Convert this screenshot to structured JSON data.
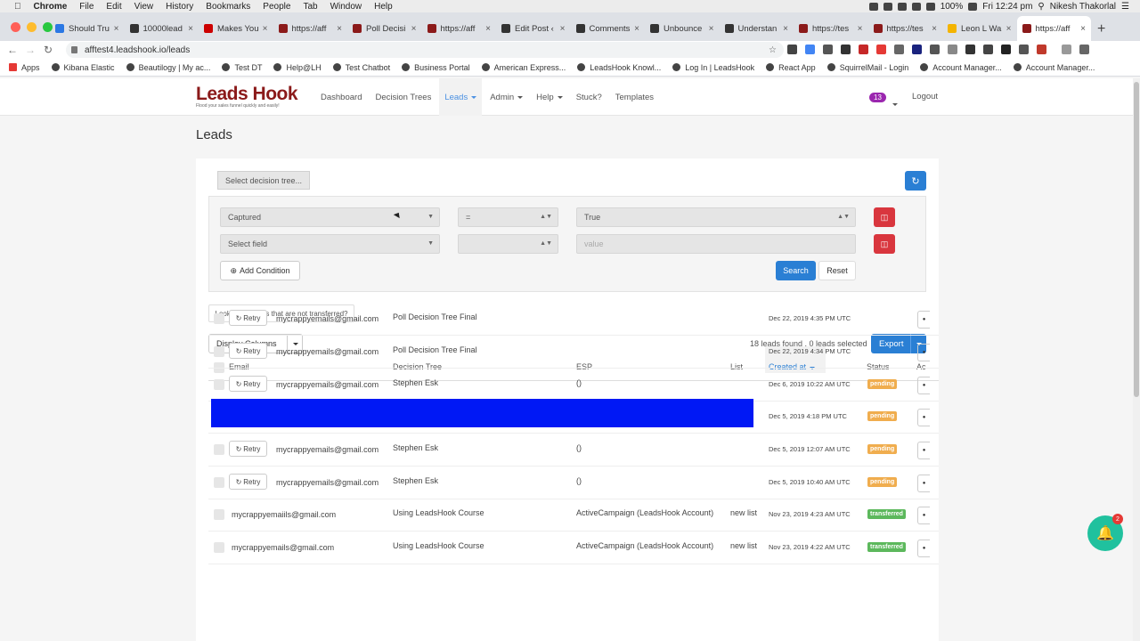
{
  "macos": {
    "menu": [
      "Chrome",
      "File",
      "Edit",
      "View",
      "History",
      "Bookmarks",
      "People",
      "Tab",
      "Window",
      "Help"
    ],
    "battery": "100%",
    "time": "Fri 12:24 pm",
    "user": "Nikesh Thakorlal"
  },
  "tabs": [
    {
      "title": "Should Tru",
      "color": "#2b78e4"
    },
    {
      "title": "10000lead",
      "color": "#333333"
    },
    {
      "title": "Makes You",
      "color": "#cc0000"
    },
    {
      "title": "https://aff",
      "color": "#8b1a1a"
    },
    {
      "title": "Poll Decisi",
      "color": "#8b1a1a"
    },
    {
      "title": "https://aff",
      "color": "#8b1a1a"
    },
    {
      "title": "Edit Post ‹",
      "color": "#333333"
    },
    {
      "title": "Comments",
      "color": "#333333"
    },
    {
      "title": "Unbounce",
      "color": "#333333"
    },
    {
      "title": "Understan",
      "color": "#333333"
    },
    {
      "title": "https://tes",
      "color": "#8b1a1a"
    },
    {
      "title": "https://tes",
      "color": "#8b1a1a"
    },
    {
      "title": "Leon L Wa",
      "color": "#f4b400"
    },
    {
      "title": "https://aff",
      "color": "#8b1a1a",
      "active": true
    }
  ],
  "address": {
    "url": "afftest4.leadshook.io/leads"
  },
  "bookmarks": [
    "Apps",
    "Kibana Elastic",
    "Beautilogy | My ac...",
    "Test DT",
    "Help@LH",
    "Test Chatbot",
    "Business Portal",
    "American Express...",
    "LeadsHook Knowl...",
    "Log In | LeadsHook",
    "React App",
    "SquirrelMail - Login",
    "Account Manager...",
    "Account Manager..."
  ],
  "brand": {
    "name": "Leads Hook",
    "tagline": "Flood your sales funnel quickly and easily!",
    "color": "#8b1a1a"
  },
  "nav": {
    "items": [
      {
        "label": "Dashboard",
        "dropdown": false
      },
      {
        "label": "Decision Trees",
        "dropdown": false
      },
      {
        "label": "Leads",
        "dropdown": true,
        "active": true
      },
      {
        "label": "Admin",
        "dropdown": true
      },
      {
        "label": "Help",
        "dropdown": true
      },
      {
        "label": "Stuck?",
        "dropdown": false
      },
      {
        "label": "Templates",
        "dropdown": false
      }
    ],
    "notifications": "13",
    "logout": "Logout"
  },
  "page": {
    "title": "Leads"
  },
  "filters": {
    "decision_tree_placeholder": "Select decision tree...",
    "conditions": [
      {
        "field": "Captured",
        "operator": "=",
        "value": "True"
      },
      {
        "field": "Select field",
        "operator": "",
        "value": "",
        "value_placeholder": "value"
      }
    ],
    "add_condition": "Add Condition",
    "search": "Search",
    "reset": "Reset"
  },
  "not_transferred_link": "Looking for leads that are not transferred?",
  "display_columns": "Display Columns",
  "results_summary": "18 leads found , 0 leads selected",
  "export": "Export",
  "table": {
    "headers": {
      "email": "Email",
      "tree": "Decision Tree",
      "esp": "ESP",
      "list": "List",
      "created": "Created at",
      "status": "Status",
      "actions": "Ac"
    },
    "retry_label": "Retry",
    "rows": [
      {
        "retry": true,
        "email": "mycrappyemails@gmail.com",
        "tree": "Poll Decision Tree Final",
        "esp": "",
        "list": "",
        "created": "Dec 22, 2019 4:35 PM UTC",
        "status": ""
      },
      {
        "retry": true,
        "email": "mycrappyemails@gmail.com",
        "tree": "Poll Decision Tree Final",
        "esp": "",
        "list": "",
        "created": "Dec 22, 2019 4:34 PM UTC",
        "status": ""
      },
      {
        "retry": true,
        "email": "mycrappyemails@gmail.com",
        "tree": "Stephen Esk",
        "esp": "()",
        "list": "",
        "created": "Dec 6, 2019 10:22 AM UTC",
        "status": "pending"
      },
      {
        "retry": false,
        "email": "",
        "tree": "",
        "esp": "",
        "list": "",
        "created": "Dec 5, 2019 4:18 PM UTC",
        "status": "pending",
        "redacted": true
      },
      {
        "retry": true,
        "email": "mycrappyemails@gmail.com",
        "tree": "Stephen Esk",
        "esp": "()",
        "list": "",
        "created": "Dec 5, 2019 12:07 AM UTC",
        "status": "pending"
      },
      {
        "retry": true,
        "email": "mycrappyemails@gmail.com",
        "tree": "Stephen Esk",
        "esp": "()",
        "list": "",
        "created": "Dec 5, 2019 10:40 AM UTC",
        "status": "pending"
      },
      {
        "retry": false,
        "email": "mycrappyemaiils@gmail.com",
        "tree": "Using LeadsHook Course",
        "esp": "ActiveCampaign (LeadsHook Account)",
        "list": "new list",
        "created": "Nov 23, 2019 4:23 AM UTC",
        "status": "transferred"
      },
      {
        "retry": false,
        "email": "mycrappyemails@gmail.com",
        "tree": "Using LeadsHook Course",
        "esp": "ActiveCampaign (LeadsHook Account)",
        "list": "new list",
        "created": "Nov 23, 2019 4:22 AM UTC",
        "status": "transferred"
      }
    ]
  },
  "status_colors": {
    "pending": "#f0ad4e",
    "transferred": "#5cb85c"
  },
  "chat_badge": "2"
}
